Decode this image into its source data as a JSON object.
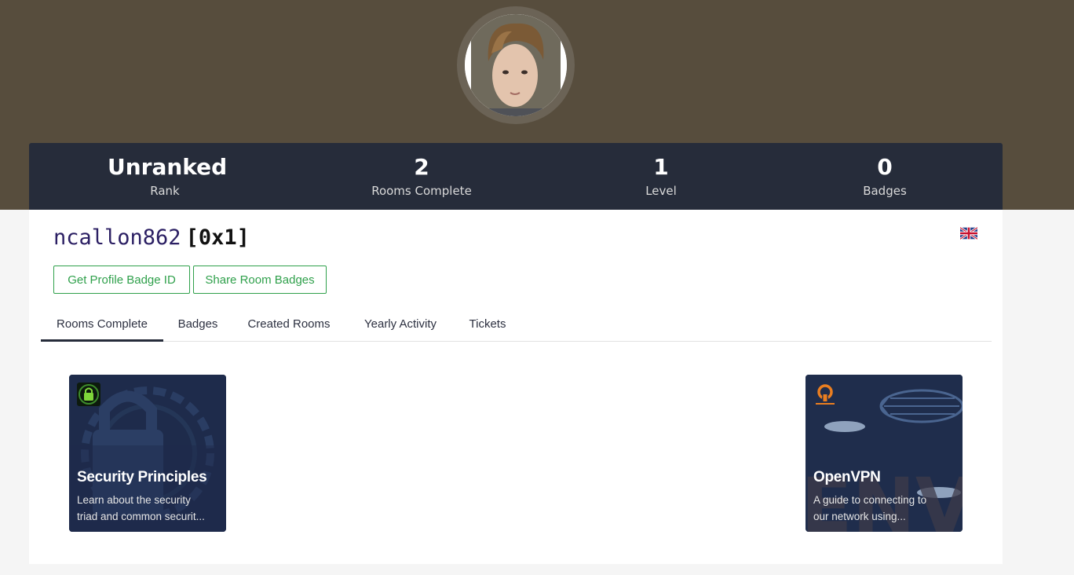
{
  "profile": {
    "username": "ncallon862",
    "rank_tag": "[0x1]",
    "flag_icon": "uk-flag-icon"
  },
  "stats": [
    {
      "value": "Unranked",
      "label": "Rank"
    },
    {
      "value": "2",
      "label": "Rooms Complete"
    },
    {
      "value": "1",
      "label": "Level"
    },
    {
      "value": "0",
      "label": "Badges"
    }
  ],
  "buttons": {
    "profile_badge": "Get Profile Badge ID",
    "share_badges": "Share Room Badges"
  },
  "tabs": [
    {
      "label": "Rooms Complete",
      "active": true
    },
    {
      "label": "Badges",
      "active": false
    },
    {
      "label": "Created Rooms",
      "active": false
    },
    {
      "label": "Yearly Activity",
      "active": false
    },
    {
      "label": "Tickets",
      "active": false
    }
  ],
  "rooms": [
    {
      "title": "Security Principles",
      "desc_line1": "Learn about the security",
      "desc_line2": "triad and common securit...",
      "icon": "padlock-icon"
    },
    {
      "title": "OpenVPN",
      "desc_line1": "A guide to connecting to",
      "desc_line2": "our network using...",
      "icon": "openvpn-logo-icon"
    }
  ],
  "colors": {
    "banner": "#574d3d",
    "stats_bar": "#262c3a",
    "accent_green": "#2fa04b",
    "username": "#2b1f63"
  }
}
